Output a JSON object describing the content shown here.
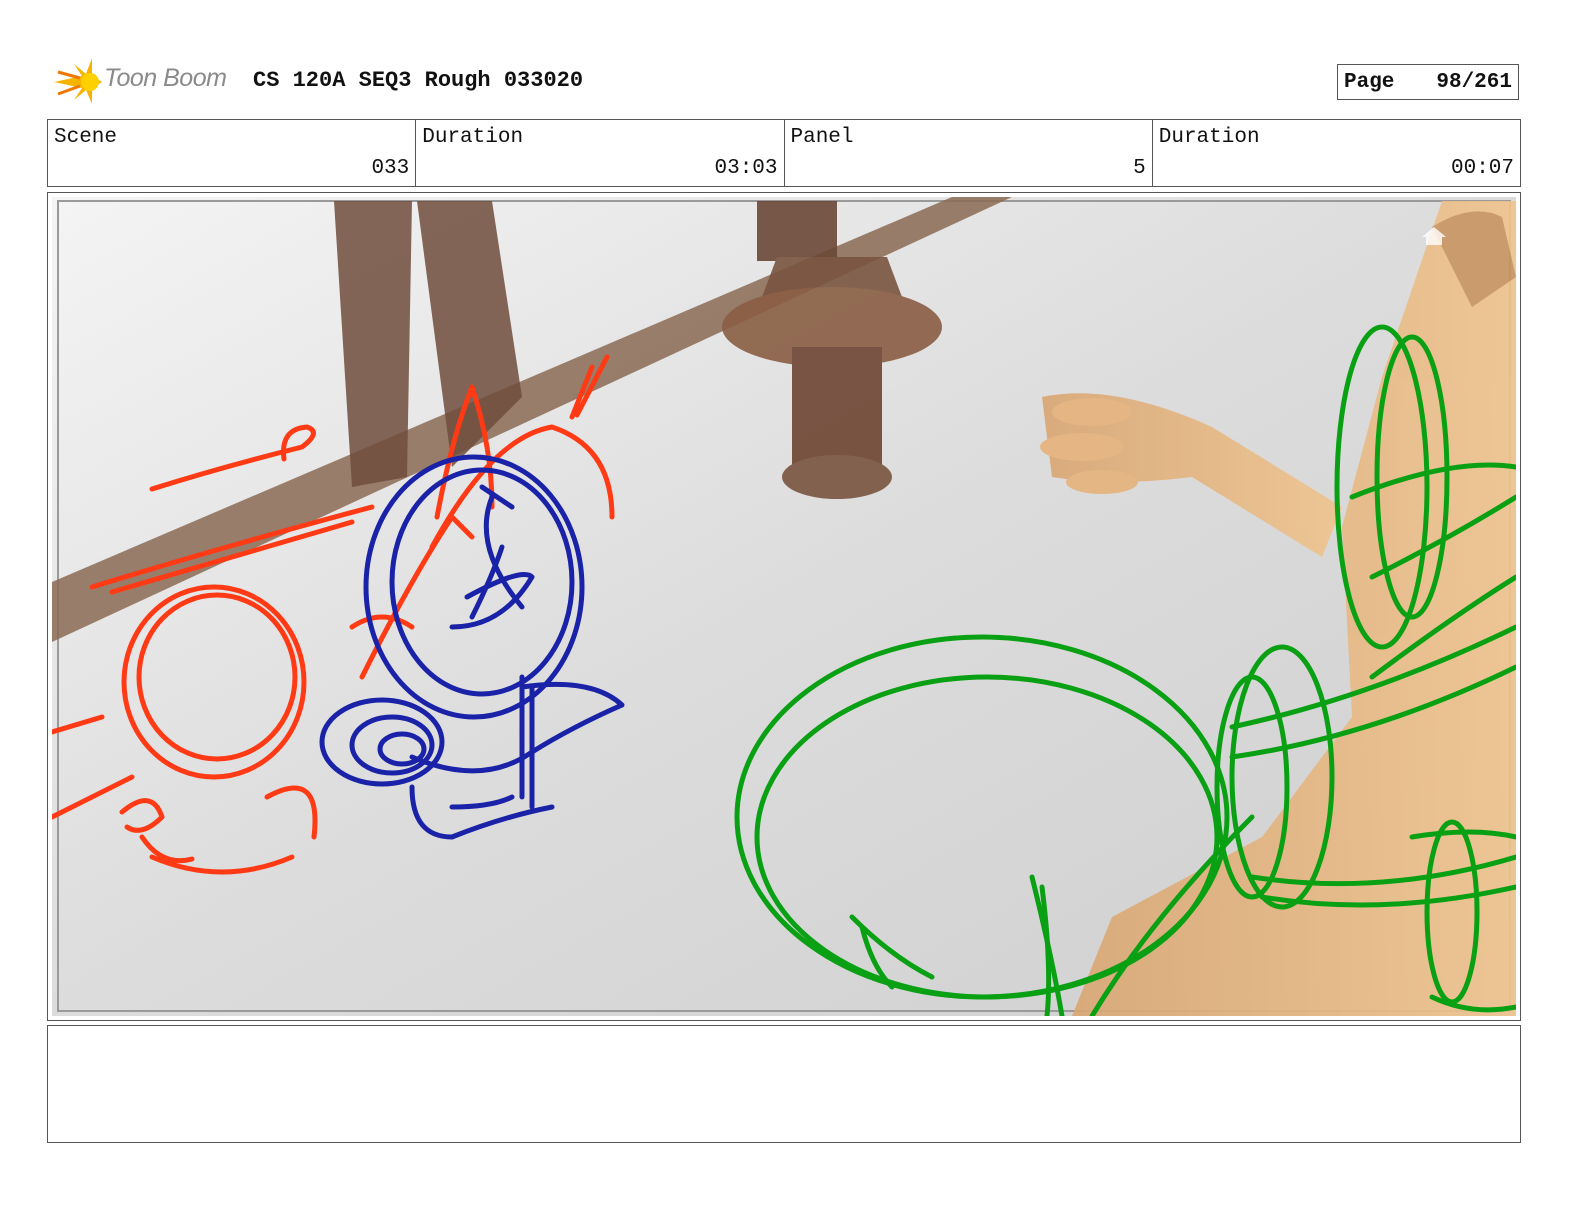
{
  "header": {
    "logo_text": "Toon Boom",
    "title": "CS 120A SEQ3 Rough 033020",
    "page_label": "Page",
    "page_value": "98/261"
  },
  "info": {
    "scene_label": "Scene",
    "scene_value": "033",
    "scene_duration_label": "Duration",
    "scene_duration_value": "03:03",
    "panel_label": "Panel",
    "panel_value": "5",
    "panel_duration_label": "Duration",
    "panel_duration_value": "00:07"
  },
  "panel": {
    "sketch_colors": {
      "red_character": "#ff3a14",
      "blue_character": "#1a22a8",
      "green_character": "#0aa014"
    },
    "background_colors": {
      "floor": "#dcdcdc",
      "wood": "#7a5a44",
      "character_skin": "#e6b27a"
    }
  },
  "notes": {
    "text": ""
  }
}
